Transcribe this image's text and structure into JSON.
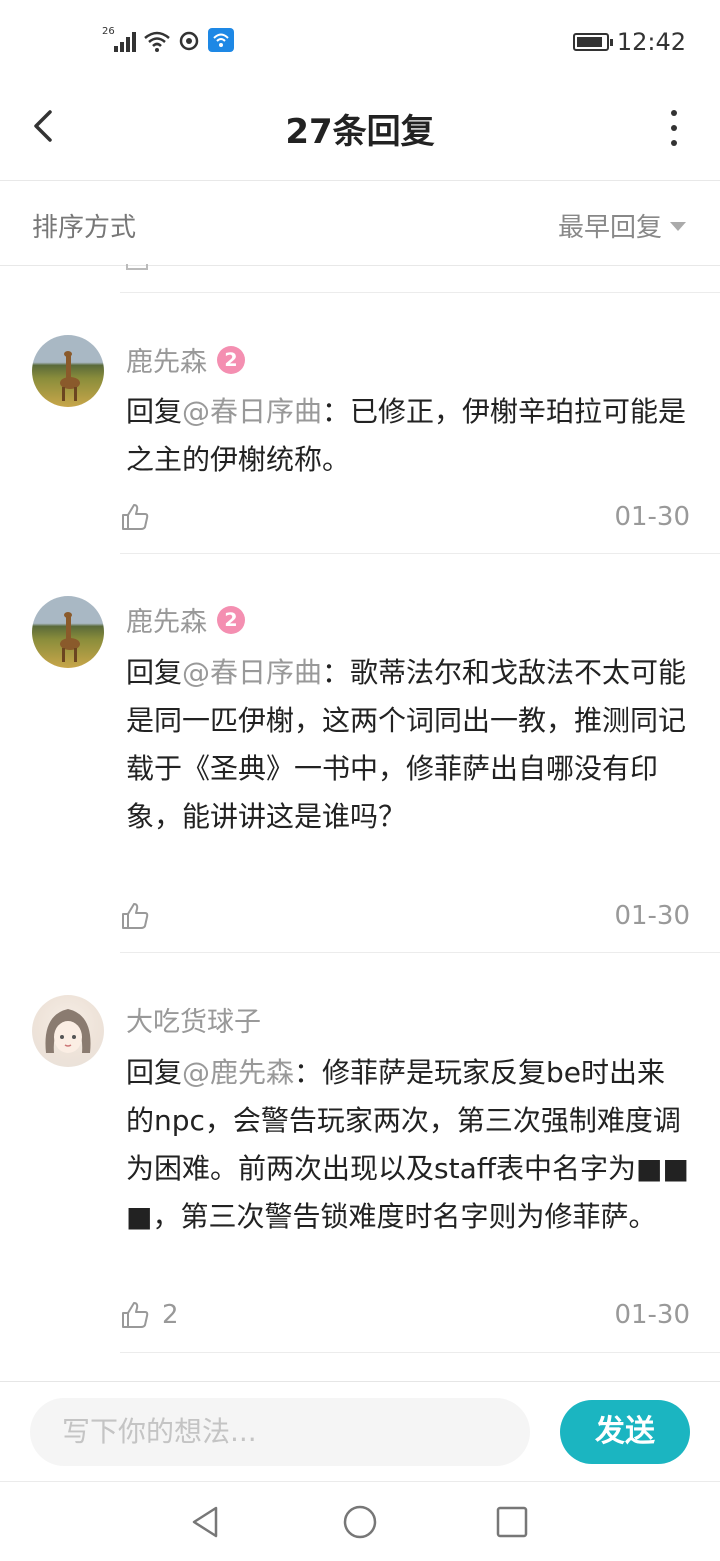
{
  "status_bar": {
    "network": "26",
    "time": "12:42",
    "battery_level": 0.9,
    "icons": [
      "signal-icon",
      "wifi-icon",
      "data-saver-icon",
      "wifi-assist-icon",
      "battery-icon"
    ]
  },
  "header": {
    "title": "27条回复",
    "back_icon": "chevron-left-icon",
    "more_icon": "more-vertical-icon"
  },
  "sort": {
    "label": "排序方式",
    "value": "最早回复"
  },
  "comments": [
    {
      "username": "鹿先森",
      "level": "2",
      "prefix": "回复",
      "mention": "@春日序曲",
      "text": "：已修正，伊榭辛珀拉可能是之主的伊榭统称。",
      "likes": "",
      "date": "01-30"
    },
    {
      "username": "鹿先森",
      "level": "2",
      "prefix": "回复",
      "mention": "@春日序曲",
      "text": "：歌蒂法尔和戈敌法不太可能是同一匹伊榭，这两个词同出一教，推测同记载于《圣典》一书中，修菲萨出自哪没有印象，能讲讲这是谁吗？",
      "likes": "",
      "date": "01-30"
    },
    {
      "username": "大吃货球子",
      "level": "",
      "prefix": "回复",
      "mention": "@鹿先森",
      "text": "：修菲萨是玩家反复be时出来的npc，会警告玩家两次，第三次强制难度调为困难。前两次出现以及staff表中名字为■■■，第三次警告锁难度时名字则为修菲萨。",
      "likes": "2",
      "date": "01-30"
    }
  ],
  "input": {
    "placeholder": "写下你的想法...",
    "send_label": "发送"
  },
  "nav": {
    "icons": [
      "back-triangle-icon",
      "home-circle-icon",
      "recents-square-icon"
    ]
  },
  "colors": {
    "accent": "#1bb5c1",
    "badge": "#f48fb1",
    "muted": "#999999"
  }
}
